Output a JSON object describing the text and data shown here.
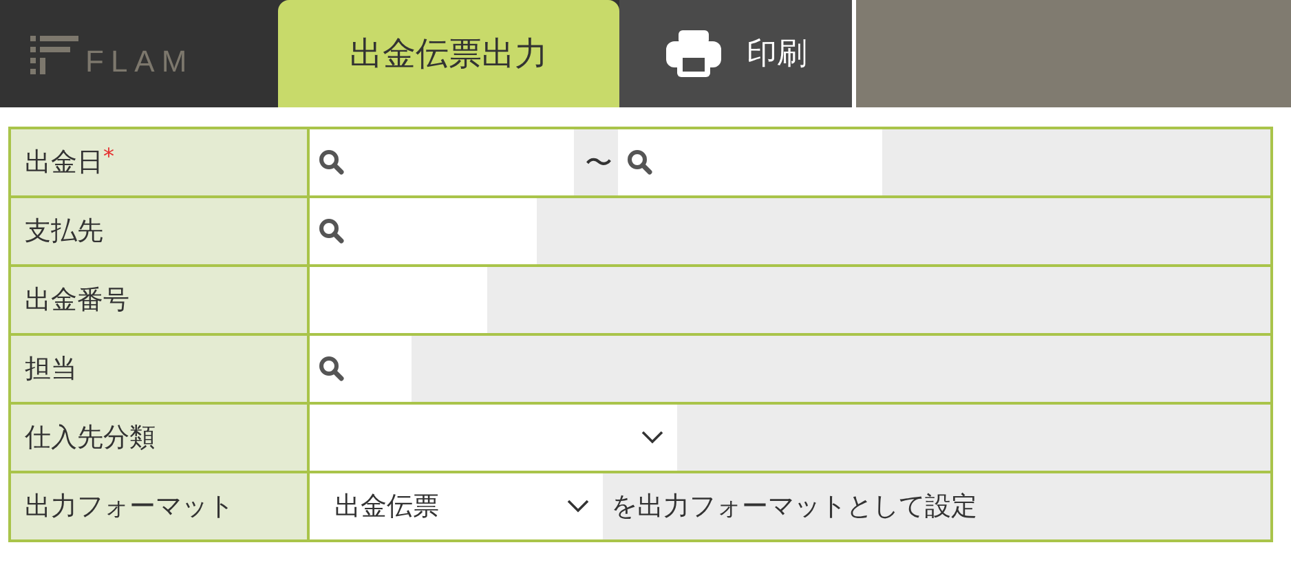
{
  "header": {
    "logo": "FLAM",
    "tab": {
      "label": "出金伝票出力",
      "selected": true
    },
    "print_button": "印刷"
  },
  "form": [
    {
      "label": "出金日",
      "required_mark": "*",
      "kind": "range_search",
      "separator": "〜"
    },
    {
      "label": "支払先",
      "kind": "search"
    },
    {
      "label": "出金番号",
      "kind": "text"
    },
    {
      "label": "担当",
      "kind": "search"
    },
    {
      "label": "仕入先分類",
      "kind": "select"
    },
    {
      "label": "出力フォーマット",
      "kind": "select",
      "value": "出金伝票",
      "note": "を出力フォーマットとして設定"
    }
  ]
}
